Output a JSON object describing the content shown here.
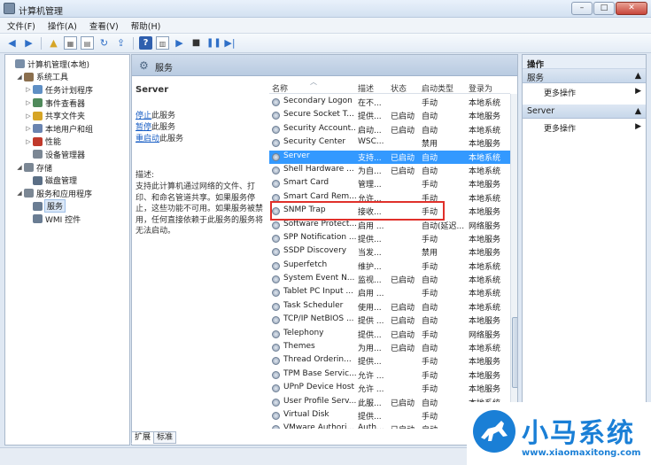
{
  "window": {
    "title": "计算机管理",
    "buttons": [
      "–",
      "□",
      "✕"
    ]
  },
  "menu": [
    "文件(F)",
    "操作(A)",
    "查看(V)",
    "帮助(H)"
  ],
  "tree": [
    {
      "label": "计算机管理(本地)",
      "level": 0,
      "arrow": "",
      "icon_color": "#7a8fa8",
      "selected": false
    },
    {
      "label": "系统工具",
      "level": 1,
      "arrow": "◢",
      "icon_color": "#8b6f4e",
      "selected": false
    },
    {
      "label": "任务计划程序",
      "level": 2,
      "arrow": "▷",
      "icon_color": "#5f8fc4",
      "selected": false
    },
    {
      "label": "事件查看器",
      "level": 2,
      "arrow": "▷",
      "icon_color": "#4f8a5b",
      "selected": false
    },
    {
      "label": "共享文件夹",
      "level": 2,
      "arrow": "▷",
      "icon_color": "#d6a526",
      "selected": false
    },
    {
      "label": "本地用户和组",
      "level": 2,
      "arrow": "▷",
      "icon_color": "#6a84b0",
      "selected": false
    },
    {
      "label": "性能",
      "level": 2,
      "arrow": "▷",
      "icon_color": "#c0392b",
      "selected": false
    },
    {
      "label": "设备管理器",
      "level": 2,
      "arrow": "",
      "icon_color": "#7b8794",
      "selected": false
    },
    {
      "label": "存储",
      "level": 1,
      "arrow": "◢",
      "icon_color": "#7b8794",
      "selected": false
    },
    {
      "label": "磁盘管理",
      "level": 2,
      "arrow": "",
      "icon_color": "#5b6f86",
      "selected": false
    },
    {
      "label": "服务和应用程序",
      "level": 1,
      "arrow": "◢",
      "icon_color": "#7b8794",
      "selected": false
    },
    {
      "label": "服务",
      "level": 2,
      "arrow": "",
      "icon_color": "#6a7d93",
      "selected": true
    },
    {
      "label": "WMI 控件",
      "level": 2,
      "arrow": "",
      "icon_color": "#6a7d93",
      "selected": false
    }
  ],
  "center": {
    "header": "服务",
    "service_name": "Server",
    "links": [
      {
        "link": "停止",
        "rest": "此服务"
      },
      {
        "link": "暂停",
        "rest": "此服务"
      },
      {
        "link": "重启动",
        "rest": "此服务"
      }
    ],
    "desc_label": "描述:",
    "desc_text": "支持此计算机通过网络的文件、打印、和命名管道共享。如果服务停止，这些功能不可用。如果服务被禁用，任何直接依赖于此服务的服务将无法启动。"
  },
  "columns": [
    "名称",
    "描述",
    "状态",
    "启动类型",
    "登录为"
  ],
  "services": [
    {
      "name": "Secondary Logon",
      "desc": "在不...",
      "status": "",
      "startup": "手动",
      "logon": "本地系统"
    },
    {
      "name": "Secure Socket T...",
      "desc": "提供...",
      "status": "已启动",
      "startup": "自动",
      "logon": "本地服务"
    },
    {
      "name": "Security Account...",
      "desc": "启动...",
      "status": "已启动",
      "startup": "自动",
      "logon": "本地系统"
    },
    {
      "name": "Security Center",
      "desc": "WSC...",
      "status": "",
      "startup": "禁用",
      "logon": "本地服务"
    },
    {
      "name": "Server",
      "desc": "支持...",
      "status": "已启动",
      "startup": "自动",
      "logon": "本地系统",
      "selected": true
    },
    {
      "name": "Shell Hardware ...",
      "desc": "为自...",
      "status": "已启动",
      "startup": "自动",
      "logon": "本地系统"
    },
    {
      "name": "Smart Card",
      "desc": "管理...",
      "status": "",
      "startup": "手动",
      "logon": "本地服务"
    },
    {
      "name": "Smart Card Rem...",
      "desc": "允许...",
      "status": "",
      "startup": "手动",
      "logon": "本地系统"
    },
    {
      "name": "SNMP Trap",
      "desc": "接收...",
      "status": "",
      "startup": "手动",
      "logon": "本地服务"
    },
    {
      "name": "Software Protect...",
      "desc": "启用 ...",
      "status": "",
      "startup": "自动(延迟...",
      "logon": "网络服务"
    },
    {
      "name": "SPP Notification ...",
      "desc": "提供...",
      "status": "",
      "startup": "手动",
      "logon": "本地服务"
    },
    {
      "name": "SSDP Discovery",
      "desc": "当发...",
      "status": "",
      "startup": "禁用",
      "logon": "本地服务"
    },
    {
      "name": "Superfetch",
      "desc": "维护...",
      "status": "",
      "startup": "手动",
      "logon": "本地系统"
    },
    {
      "name": "System Event N...",
      "desc": "监视...",
      "status": "已启动",
      "startup": "自动",
      "logon": "本地系统"
    },
    {
      "name": "Tablet PC Input ...",
      "desc": "启用 ...",
      "status": "",
      "startup": "手动",
      "logon": "本地系统"
    },
    {
      "name": "Task Scheduler",
      "desc": "使用...",
      "status": "已启动",
      "startup": "自动",
      "logon": "本地系统"
    },
    {
      "name": "TCP/IP NetBIOS ...",
      "desc": "提供 ...",
      "status": "已启动",
      "startup": "自动",
      "logon": "本地服务"
    },
    {
      "name": "Telephony",
      "desc": "提供...",
      "status": "已启动",
      "startup": "手动",
      "logon": "网络服务"
    },
    {
      "name": "Themes",
      "desc": "为用...",
      "status": "已启动",
      "startup": "自动",
      "logon": "本地系统"
    },
    {
      "name": "Thread Orderin...",
      "desc": "提供...",
      "status": "",
      "startup": "手动",
      "logon": "本地服务"
    },
    {
      "name": "TPM Base Servic...",
      "desc": "允许 ...",
      "status": "",
      "startup": "手动",
      "logon": "本地服务"
    },
    {
      "name": "UPnP Device Host",
      "desc": "允许 ...",
      "status": "",
      "startup": "手动",
      "logon": "本地服务"
    },
    {
      "name": "User Profile Serv...",
      "desc": "此服...",
      "status": "已启动",
      "startup": "自动",
      "logon": "本地系统"
    },
    {
      "name": "Virtual Disk",
      "desc": "提供...",
      "status": "",
      "startup": "手动",
      "logon": "本地系统"
    },
    {
      "name": "VMware Authori...",
      "desc": "Auth...",
      "status": "已启动",
      "startup": "自动",
      "logon": "本地系统"
    }
  ],
  "tabs": [
    "扩展",
    "标准"
  ],
  "actions": {
    "title": "操作",
    "sections": [
      {
        "label": "服务",
        "items": [
          "更多操作"
        ]
      },
      {
        "label": "Server",
        "items": [
          "更多操作"
        ]
      }
    ]
  },
  "watermark": {
    "title": "小马系统",
    "url": "www.xiaomaxitong.com"
  }
}
